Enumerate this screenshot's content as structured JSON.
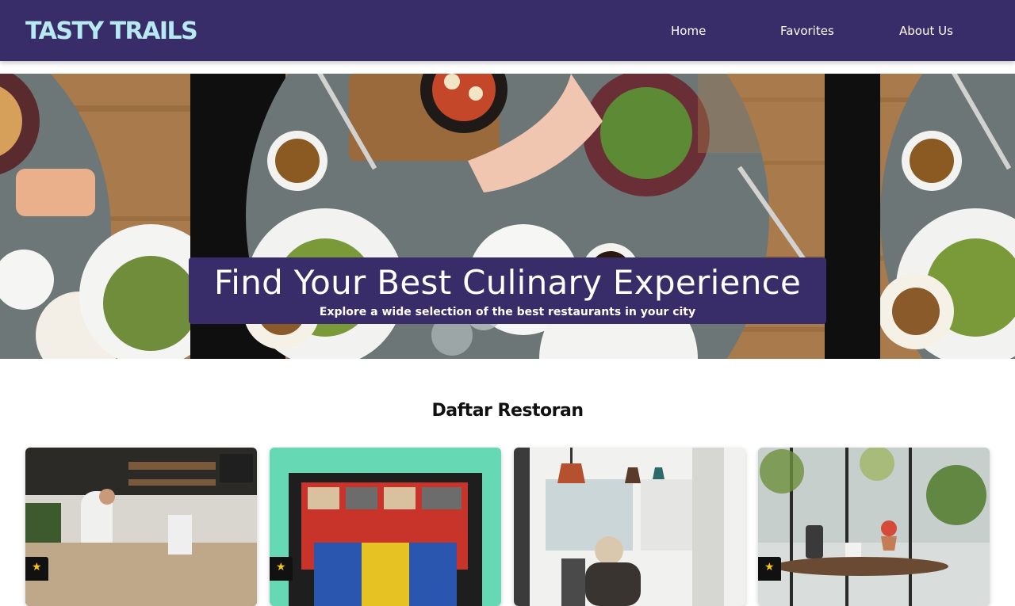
{
  "header": {
    "brand": "TASTY TRAILS",
    "nav": {
      "home": "Home",
      "favorites": "Favorites",
      "about": "About Us"
    }
  },
  "hero": {
    "title": "Find Your Best Culinary Experience",
    "subtitle": "Explore a wide selection of the best restaurants in your city"
  },
  "section": {
    "title": "Daftar Restoran"
  },
  "cards": [
    {
      "image": "restaurant-kitchen-image",
      "rating_icon": "star-icon"
    },
    {
      "image": "restaurant-storefront-image",
      "rating_icon": "star-icon"
    },
    {
      "image": "restaurant-cafe-image",
      "rating_icon": "star-icon"
    },
    {
      "image": "restaurant-greenhouse-image",
      "rating_icon": "star-icon"
    }
  ],
  "colors": {
    "navbar": "#392d69",
    "brand_text": "#b6eaf0",
    "caption_bg": "#392d69"
  }
}
